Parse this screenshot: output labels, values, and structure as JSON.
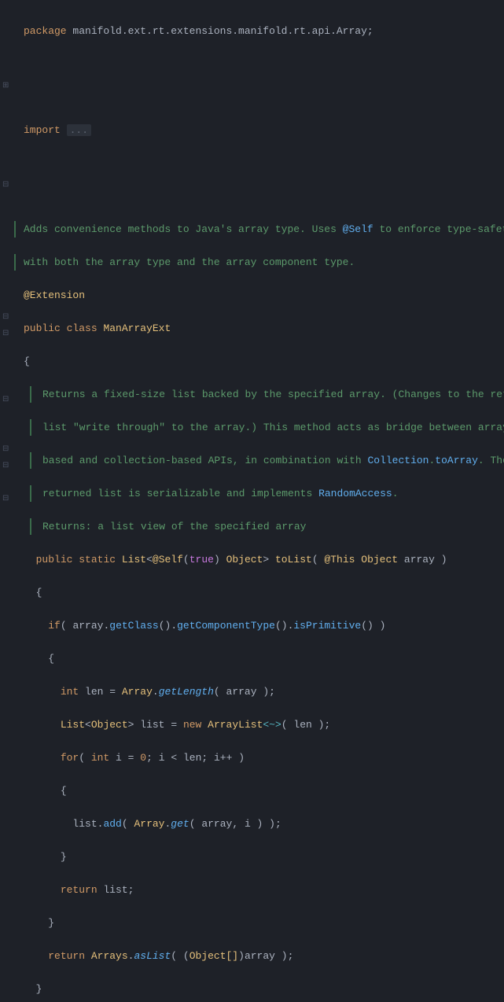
{
  "pkg": {
    "kw": "package",
    "path": "manifold.ext.rt.extensions.manifold.rt.api.Array",
    "semi": ";"
  },
  "imp": {
    "kw": "import",
    "folded": "..."
  },
  "classdoc": {
    "l1a": "Adds convenience methods to Java's array type. Uses ",
    "l1link": "@Self",
    "l1b": " to enforce type-safety",
    "l2": "with both the array type and the array component type."
  },
  "anno_ext": "@Extension",
  "cls": {
    "public": "public",
    "class": "class",
    "name": "ManArrayExt"
  },
  "obrace": "{",
  "cbrace": "}",
  "mdoc": {
    "l1": "Returns a fixed-size list backed by the specified array. (Changes to the returned",
    "l2": "list \"write through\" to the array.) This method acts as bridge between array-",
    "l3a": "based and collection-based APIs, in combination with ",
    "l3link1": "Collection",
    "l3dot": ".",
    "l3link2": "toArray",
    "l3b": ". The",
    "l4a": "returned list is serializable and implements ",
    "l4link": "RandomAccess",
    "l4b": ".",
    "l5": "Returns: a list view of the specified array"
  },
  "sig": {
    "public": "public",
    "static": "static",
    "List": "List",
    "lt": "<",
    "Self": "@Self",
    "op": "(",
    "true": "true",
    "cp": ")",
    "sp": " ",
    "Object": "Object",
    "gt": ">",
    "name": "toList",
    "op2": "(",
    "This": "@This",
    "Object2": "Object",
    "param": "array",
    "cp2": ")"
  },
  "body": {
    "if_kw": "if",
    "if_op": "(",
    "arr1": "array",
    "dot": ".",
    "getClass": "getClass",
    "pp": "()",
    "getComponentType": "getComponentType",
    "isPrimitive": "isPrimitive",
    "if_cp": ")",
    "int": "int",
    "len": "len",
    "eq": "=",
    "Array": "Array",
    "getLength": "getLength",
    "array2": "array",
    "semi": ";",
    "ListT": "List",
    "ObjectT": "Object",
    "list": "list",
    "new": "new",
    "ArrayList": "ArrayList",
    "diamond": "<~>",
    "len2": "len",
    "for": "for",
    "int2": "int",
    "i": "i",
    "zero": "0",
    "lt2": "<",
    "len3": "len",
    "ipp": "i++",
    "list2": "list",
    "add": "add",
    "Array2": "Array",
    "get": "get",
    "array3": "array",
    "i2": "i",
    "return": "return",
    "list3": "list",
    "return2": "return",
    "Arrays": "Arrays",
    "asList": "asList",
    "cast_op": "(",
    "ObjectArr": "Object[]",
    "cast_cp": ")",
    "array4": "array"
  }
}
